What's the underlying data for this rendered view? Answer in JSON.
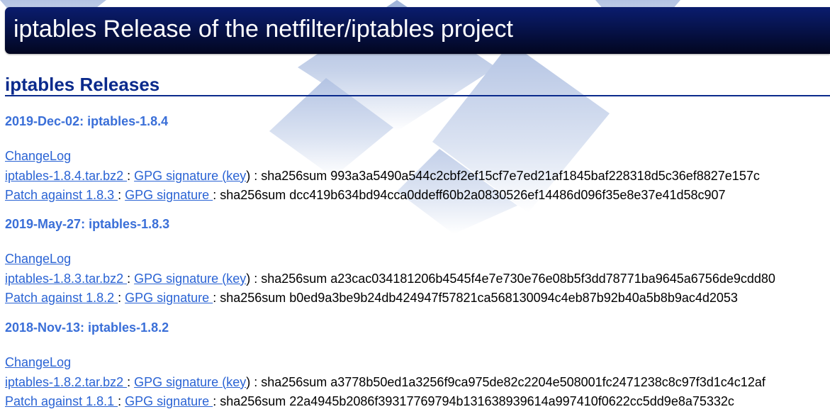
{
  "banner": {
    "title": "iptables Release of the netfilter/iptables project"
  },
  "section": {
    "title": "iptables Releases"
  },
  "common": {
    "gpg_label": "GPG signature ",
    "key_label": "key",
    "changelog_label": "ChangeLog",
    "colon_sep": " : ",
    "open_paren": "(",
    "close_paren_sep": ") : ",
    "sha_prefix": "sha256sum "
  },
  "releases": [
    {
      "date_title": "2019-Dec-02: iptables-1.8.4",
      "tarball_label": "iptables-1.8.4.tar.bz2 ",
      "tarball_sha": "993a3a5490a544c2cbf2ef15cf7e7ed21af1845baf228318d5c36ef8827e157c",
      "patch_label": "Patch against 1.8.3 ",
      "patch_sha": "dcc419b634bd94cca0ddeff60b2a0830526ef14486d096f35e8e37e41d58c907"
    },
    {
      "date_title": "2019-May-27: iptables-1.8.3",
      "tarball_label": "iptables-1.8.3.tar.bz2 ",
      "tarball_sha": "a23cac034181206b4545f4e7e730e76e08b5f3dd78771ba9645a6756de9cdd80",
      "patch_label": "Patch against 1.8.2 ",
      "patch_sha": "b0ed9a3be9b24db424947f57821ca568130094c4eb87b92b40a5b8b9ac4d2053"
    },
    {
      "date_title": "2018-Nov-13: iptables-1.8.2",
      "tarball_label": "iptables-1.8.2.tar.bz2 ",
      "tarball_sha": "a3778b50ed1a3256f9ca975de82c2204e508001fc2471238c8c97f3d1c4c12af",
      "patch_label": "Patch against 1.8.1 ",
      "patch_sha": "22a4945b2086f39317769794b131638939614a997410f0622cc5dd9e8a75332c"
    }
  ]
}
